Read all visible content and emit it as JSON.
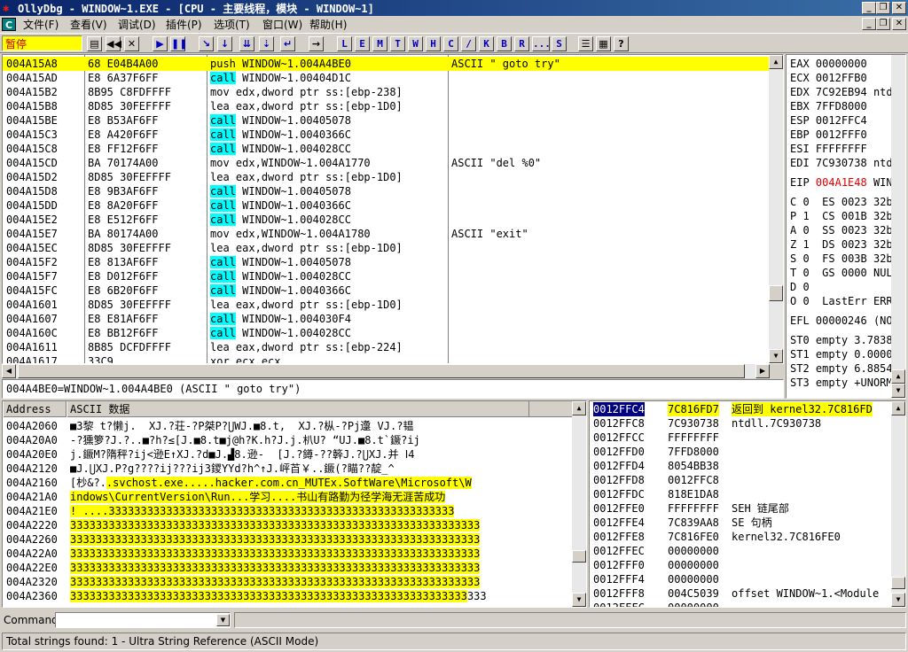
{
  "window": {
    "title": "OllyDbg - WINDOW~1.EXE - [CPU - 主要线程，模块 - WINDOW~1]",
    "minimize_glyph": "_",
    "restore_glyph": "❐",
    "close_glyph": "✕"
  },
  "menu": {
    "app_icon": "C",
    "items": [
      {
        "label": "文件(F)"
      },
      {
        "label": "查看(V)"
      },
      {
        "label": "调试(D)"
      },
      {
        "label": "插件(P)"
      },
      {
        "label": "选项(T)"
      },
      {
        "label": "窗口(W)"
      },
      {
        "label": "帮助(H)"
      }
    ]
  },
  "toolbar": {
    "status": "暂停",
    "buttons": [
      {
        "name": "open-icon",
        "glyph": "▤"
      },
      {
        "name": "rewind-icon",
        "glyph": "◀◀"
      },
      {
        "name": "close-icon",
        "glyph": "✕"
      },
      {
        "name": "run-icon",
        "glyph": "▶"
      },
      {
        "name": "pause-icon",
        "glyph": "❚❚"
      },
      {
        "name": "step-into-icon",
        "glyph": "↘"
      },
      {
        "name": "step-over-icon",
        "glyph": "↓"
      },
      {
        "name": "trace-into-icon",
        "glyph": "⇊"
      },
      {
        "name": "trace-over-icon",
        "glyph": "⇣"
      },
      {
        "name": "execute-till-return-icon",
        "glyph": "↵"
      },
      {
        "name": "goto-icon",
        "glyph": "→"
      }
    ],
    "letters": [
      "L",
      "E",
      "M",
      "T",
      "W",
      "H",
      "C",
      "/",
      "K",
      "B",
      "R",
      "...",
      "S"
    ],
    "right_buttons": [
      {
        "name": "list-icon",
        "glyph": "☰"
      },
      {
        "name": "grid-icon",
        "glyph": "▦"
      },
      {
        "name": "help-icon",
        "glyph": "?"
      }
    ]
  },
  "disasm": {
    "rows": [
      {
        "addr": "004A15A8",
        "hex": "68 E04B4A00",
        "op": "push",
        "args": "WINDOW~1.004A4BE0",
        "comment": "ASCII \" goto try\"",
        "selected": true
      },
      {
        "addr": "004A15AD",
        "hex": "E8 6A37F6FF",
        "op": "call",
        "args": "WINDOW~1.00404D1C",
        "comment": ""
      },
      {
        "addr": "004A15B2",
        "hex": "8B95 C8FDFFFF",
        "op": "mov",
        "args": "edx,dword ptr ss:[ebp-238]",
        "comment": ""
      },
      {
        "addr": "004A15B8",
        "hex": "8D85 30FEFFFF",
        "op": "lea",
        "args": "eax,dword ptr ss:[ebp-1D0]",
        "comment": ""
      },
      {
        "addr": "004A15BE",
        "hex": "E8 B53AF6FF",
        "op": "call",
        "args": "WINDOW~1.00405078",
        "comment": ""
      },
      {
        "addr": "004A15C3",
        "hex": "E8 A420F6FF",
        "op": "call",
        "args": "WINDOW~1.0040366C",
        "comment": ""
      },
      {
        "addr": "004A15C8",
        "hex": "E8 FF12F6FF",
        "op": "call",
        "args": "WINDOW~1.004028CC",
        "comment": ""
      },
      {
        "addr": "004A15CD",
        "hex": "BA 70174A00",
        "op": "mov",
        "args": "edx,WINDOW~1.004A1770",
        "comment": "ASCII \"del %0\""
      },
      {
        "addr": "004A15D2",
        "hex": "8D85 30FEFFFF",
        "op": "lea",
        "args": "eax,dword ptr ss:[ebp-1D0]",
        "comment": ""
      },
      {
        "addr": "004A15D8",
        "hex": "E8 9B3AF6FF",
        "op": "call",
        "args": "WINDOW~1.00405078",
        "comment": ""
      },
      {
        "addr": "004A15DD",
        "hex": "E8 8A20F6FF",
        "op": "call",
        "args": "WINDOW~1.0040366C",
        "comment": ""
      },
      {
        "addr": "004A15E2",
        "hex": "E8 E512F6FF",
        "op": "call",
        "args": "WINDOW~1.004028CC",
        "comment": ""
      },
      {
        "addr": "004A15E7",
        "hex": "BA 80174A00",
        "op": "mov",
        "args": "edx,WINDOW~1.004A1780",
        "comment": "ASCII \"exit\""
      },
      {
        "addr": "004A15EC",
        "hex": "8D85 30FEFFFF",
        "op": "lea",
        "args": "eax,dword ptr ss:[ebp-1D0]",
        "comment": ""
      },
      {
        "addr": "004A15F2",
        "hex": "E8 813AF6FF",
        "op": "call",
        "args": "WINDOW~1.00405078",
        "comment": ""
      },
      {
        "addr": "004A15F7",
        "hex": "E8 D012F6FF",
        "op": "call",
        "args": "WINDOW~1.004028CC",
        "comment": ""
      },
      {
        "addr": "004A15FC",
        "hex": "E8 6B20F6FF",
        "op": "call",
        "args": "WINDOW~1.0040366C",
        "comment": ""
      },
      {
        "addr": "004A1601",
        "hex": "8D85 30FEFFFF",
        "op": "lea",
        "args": "eax,dword ptr ss:[ebp-1D0]",
        "comment": ""
      },
      {
        "addr": "004A1607",
        "hex": "E8 E81AF6FF",
        "op": "call",
        "args": "WINDOW~1.004030F4",
        "comment": ""
      },
      {
        "addr": "004A160C",
        "hex": "E8 BB12F6FF",
        "op": "call",
        "args": "WINDOW~1.004028CC",
        "comment": ""
      },
      {
        "addr": "004A1611",
        "hex": "8B85 DCFDFFFF",
        "op": "lea",
        "args": "eax,dword ptr ss:[ebp-224]",
        "comment": ""
      },
      {
        "addr": "004A1617",
        "hex": "33C9",
        "op": "xor",
        "args": "ecx,ecx",
        "comment": ""
      }
    ]
  },
  "info_line": "004A4BE0=WINDOW~1.004A4BE0 (ASCII \" goto try\")",
  "registers": [
    {
      "name": "EAX",
      "value": "00000000",
      "note": ""
    },
    {
      "name": "ECX",
      "value": "0012FFB0",
      "note": ""
    },
    {
      "name": "EDX",
      "value": "7C92EB94",
      "note": "ntdll"
    },
    {
      "name": "EBX",
      "value": "7FFD8000",
      "note": ""
    },
    {
      "name": "ESP",
      "value": "0012FFC4",
      "note": ""
    },
    {
      "name": "EBP",
      "value": "0012FFF0",
      "note": ""
    },
    {
      "name": "ESI",
      "value": "FFFFFFFF",
      "note": ""
    },
    {
      "name": "EDI",
      "value": "7C930738",
      "note": "ntdl"
    },
    {
      "name": "EIP",
      "value": "004A1E48",
      "note": "WIND"
    }
  ],
  "flags": [
    {
      "f": "C",
      "v": "0",
      "seg": "ES",
      "sv": "0023",
      "bits": "32bi"
    },
    {
      "f": "P",
      "v": "1",
      "seg": "CS",
      "sv": "001B",
      "bits": "32bi"
    },
    {
      "f": "A",
      "v": "0",
      "seg": "SS",
      "sv": "0023",
      "bits": "32bi"
    },
    {
      "f": "Z",
      "v": "1",
      "seg": "DS",
      "sv": "0023",
      "bits": "32bi"
    },
    {
      "f": "S",
      "v": "0",
      "seg": "FS",
      "sv": "003B",
      "bits": "32bi"
    },
    {
      "f": "T",
      "v": "0",
      "seg": "GS",
      "sv": "0000",
      "bits": "NULL"
    },
    {
      "f": "D",
      "v": "0",
      "seg": "",
      "sv": "",
      "bits": ""
    },
    {
      "f": "O",
      "v": "0",
      "seg": "LastErr",
      "sv": "ERRO",
      "bits": ""
    }
  ],
  "efl": {
    "name": "EFL",
    "value": "00000246",
    "note": "(NO,"
  },
  "fpu": [
    {
      "name": "ST0",
      "tag": "empty",
      "val": "3.7838"
    },
    {
      "name": "ST1",
      "tag": "empty",
      "val": "0.0000"
    },
    {
      "name": "ST2",
      "tag": "empty",
      "val": "6.8854"
    },
    {
      "name": "ST3",
      "tag": "empty",
      "val": "+UNORM"
    }
  ],
  "dump": {
    "headers": [
      "Address",
      "ASCII 数据"
    ],
    "rows": [
      {
        "addr": "004A2060",
        "pre": "■3黎 t?懒j.  XJ.?荘-?P桀P?⋃WJ.■8.t,  XJ.?枞-?Pj邍 VJ.?韫",
        "hl": ""
      },
      {
        "addr": "004A20A0",
        "pre": "-?獯箩?J.?..■?h?≤[J.■8.t■j@h?K.h?J.j.朳U? “UJ.■8.t`鐝?ij",
        "hl": ""
      },
      {
        "addr": "004A20E0",
        "pre": "j.鐝M?隋秤?ij<逊E↑XJ.?d■J.▟8.逊-  [J.?鐏-??簳J.?⋃XJ.并 Ⅰ4",
        "hl": ""
      },
      {
        "addr": "004A2120",
        "pre": "■J.⋃XJ.P?g????ij???ij3鑁YYd?h^↑J.岼苩￥..鐝(?瞄??靛_^",
        "hl": ""
      },
      {
        "addr": "004A2160",
        "pre": "[杪&?.",
        "hl": ".svchost.exe.....hacker.com.cn_MUTEx.SoftWare\\Microsoft\\W"
      },
      {
        "addr": "004A21A0",
        "pre": "",
        "hl": "indows\\CurrentVersion\\Run...学习....书山有路勤为径学海无涯苦成功"
      },
      {
        "addr": "004A21E0",
        "pre": "",
        "hl": "! ....333333333333333333333333333333333333333333333333333333"
      },
      {
        "addr": "004A2220",
        "pre": "",
        "hl": "3333333333333333333333333333333333333333333333333333333333333333"
      },
      {
        "addr": "004A2260",
        "pre": "",
        "hl": "3333333333333333333333333333333333333333333333333333333333333333"
      },
      {
        "addr": "004A22A0",
        "pre": "",
        "hl": "3333333333333333333333333333333333333333333333333333333333333333"
      },
      {
        "addr": "004A22E0",
        "pre": "",
        "hl": "3333333333333333333333333333333333333333333333333333333333333333"
      },
      {
        "addr": "004A2320",
        "pre": "",
        "hl": "3333333333333333333333333333333333333333333333333333333333333333"
      },
      {
        "addr": "004A2360",
        "pre": "",
        "hl": "33333333333333333333333333333333333333333333333333333333333333",
        "post": "333"
      }
    ]
  },
  "stack": {
    "rows": [
      {
        "addr": "0012FFC4",
        "val": "7C816FD7",
        "cmt": "返回到 kernel32.7C816FD",
        "selected": true
      },
      {
        "addr": "0012FFC8",
        "val": "7C930738",
        "cmt": "ntdll.7C930738"
      },
      {
        "addr": "0012FFCC",
        "val": "FFFFFFFF",
        "cmt": ""
      },
      {
        "addr": "0012FFD0",
        "val": "7FFD8000",
        "cmt": ""
      },
      {
        "addr": "0012FFD4",
        "val": "8054BB38",
        "cmt": ""
      },
      {
        "addr": "0012FFD8",
        "val": "0012FFC8",
        "cmt": ""
      },
      {
        "addr": "0012FFDC",
        "val": "818E1DA8",
        "cmt": ""
      },
      {
        "addr": "0012FFE0",
        "val": "FFFFFFFF",
        "cmt": "SEH 链尾部"
      },
      {
        "addr": "0012FFE4",
        "val": "7C839AA8",
        "cmt": "SE 句柄"
      },
      {
        "addr": "0012FFE8",
        "val": "7C816FE0",
        "cmt": "kernel32.7C816FE0"
      },
      {
        "addr": "0012FFEC",
        "val": "00000000",
        "cmt": ""
      },
      {
        "addr": "0012FFF0",
        "val": "00000000",
        "cmt": ""
      },
      {
        "addr": "0012FFF4",
        "val": "00000000",
        "cmt": ""
      },
      {
        "addr": "0012FFF8",
        "val": "004C5039",
        "cmt": "offset WINDOW~1.<Module"
      },
      {
        "addr": "0012FFFC",
        "val": "00000000",
        "cmt": ""
      }
    ]
  },
  "command": {
    "label": "Command :",
    "value": ""
  },
  "status": {
    "text": "Total strings found: 1  - Ultra String Reference (ASCII Mode)"
  }
}
